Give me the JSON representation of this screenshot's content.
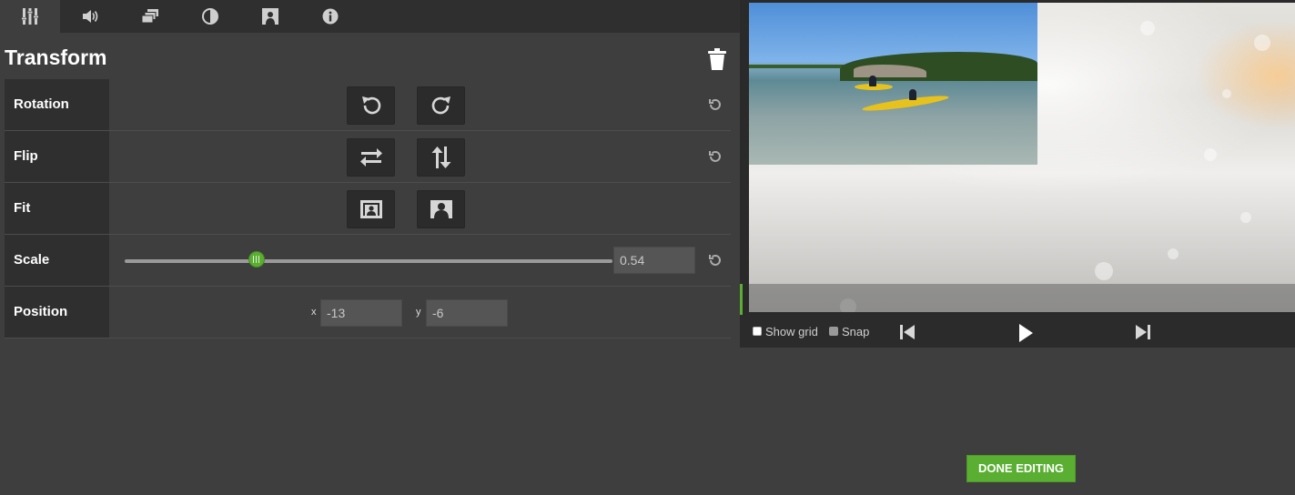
{
  "tabs": [
    {
      "icon": "sliders-icon",
      "active": true
    },
    {
      "icon": "volume-icon",
      "active": false
    },
    {
      "icon": "layers-icon",
      "active": false
    },
    {
      "icon": "contrast-icon",
      "active": false
    },
    {
      "icon": "portrait-icon",
      "active": false
    },
    {
      "icon": "info-icon",
      "active": false
    }
  ],
  "panel": {
    "title": "Transform",
    "rows": {
      "rotation": {
        "label": "Rotation"
      },
      "flip": {
        "label": "Flip"
      },
      "fit": {
        "label": "Fit"
      },
      "scale": {
        "label": "Scale",
        "value": "0.54",
        "slider_fraction": 0.27
      },
      "position": {
        "label": "Position",
        "x_label": "x",
        "x_value": "-13",
        "y_label": "y",
        "y_value": "-6"
      }
    }
  },
  "preview": {
    "show_grid_label": "Show grid",
    "snap_label": "Snap"
  },
  "done_button": "DONE EDITING",
  "colors": {
    "accent": "#5aae32",
    "panel_bg": "#3e3e3e",
    "label_bg": "#2f2f2f"
  }
}
